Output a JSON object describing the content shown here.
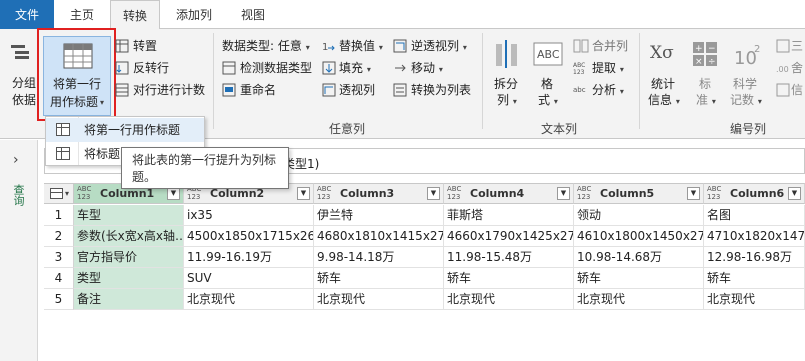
{
  "tabs": [
    {
      "label": "文件"
    },
    {
      "label": "主页"
    },
    {
      "label": "转换"
    },
    {
      "label": "添加列"
    },
    {
      "label": "视图"
    }
  ],
  "ribbon": {
    "group_table": {
      "partial_left_top": "分组",
      "partial_left_bottom": "依据",
      "big_button_line1": "将第一行",
      "big_button_line2": "用作标题",
      "transpose": "转置",
      "reverse_rows": "反转行",
      "count_rows": "对行进行计数"
    },
    "group_anycolumn": {
      "data_type": "数据类型: 任意",
      "detect_type": "检测数据类型",
      "rename": "重命名",
      "replace_values": "替换值",
      "fill": "填充",
      "pivot": "透视列",
      "unpivot": "逆透视列",
      "move": "移动",
      "to_list": "转换为列表",
      "label": "任意列"
    },
    "group_text": {
      "split_line1": "拆分",
      "split_line2": "列",
      "format_line1": "格",
      "format_line2": "式",
      "merge": "合并列",
      "extract": "提取",
      "parse": "分析",
      "label": "文本列"
    },
    "group_number": {
      "stats_line1": "统计",
      "stats_line2": "信息",
      "standard_line1": "标",
      "standard_line2": "准",
      "sci_line1": "科学",
      "sci_line2": "记数",
      "partial_tri": "三",
      "partial_round": "舍",
      "partial_info": "信",
      "label": "编号列"
    }
  },
  "dropdown": {
    "item1": "将第一行用作标题",
    "item2": "将标题"
  },
  "tooltip": "将此表的第一行提升为列标题。",
  "formula_text": "更改的类型1)",
  "left_panel_label": "查询",
  "columns": [
    {
      "type_top": "ABC",
      "type_bot": "123",
      "name": "Column1"
    },
    {
      "type_top": "ABC",
      "type_bot": "123",
      "name": "Column2"
    },
    {
      "type_top": "ABC",
      "type_bot": "123",
      "name": "Column3"
    },
    {
      "type_top": "ABC",
      "type_bot": "123",
      "name": "Column4"
    },
    {
      "type_top": "ABC",
      "type_bot": "123",
      "name": "Column5"
    },
    {
      "type_top": "ABC",
      "type_bot": "123",
      "name": "Column6"
    }
  ],
  "rows": [
    {
      "n": "1",
      "c": [
        "车型",
        "ix35",
        "伊兰特",
        "菲斯塔",
        "领动",
        "名图"
      ]
    },
    {
      "n": "2",
      "c": [
        "参数(长x宽x高x轴…",
        "4500x1850x1715x2640",
        "4680x1810x1415x2720",
        "4660x1790x1425x2700",
        "4610x1800x1450x2700",
        "4710x1820x1470x27"
      ]
    },
    {
      "n": "3",
      "c": [
        "官方指导价",
        "11.99-16.19万",
        "9.98-14.18万",
        "11.98-15.48万",
        "10.98-14.68万",
        "12.98-16.98万"
      ]
    },
    {
      "n": "4",
      "c": [
        "类型",
        "SUV",
        "轿车",
        "轿车",
        "轿车",
        "轿车"
      ]
    },
    {
      "n": "5",
      "c": [
        "备注",
        "北京现代",
        "北京现代",
        "北京现代",
        "北京现代",
        "北京现代"
      ]
    }
  ]
}
